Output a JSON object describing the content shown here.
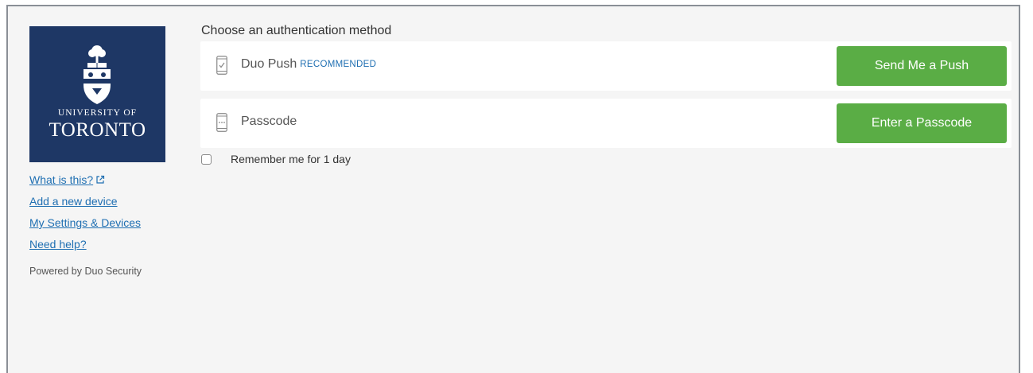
{
  "logo": {
    "line1": "UNIVERSITY OF",
    "line2": "TORONTO",
    "crest_icon": "university-crest-icon"
  },
  "sidebar": {
    "links": [
      {
        "label": "What is this?",
        "icon": "external-link-icon"
      },
      {
        "label": "Add a new device"
      },
      {
        "label": "My Settings & Devices"
      },
      {
        "label": "Need help?"
      }
    ],
    "powered_by": "Powered by Duo Security"
  },
  "main": {
    "heading": "Choose an authentication method",
    "methods": [
      {
        "name": "Duo Push",
        "badge": "RECOMMENDED",
        "icon": "phone-check-icon",
        "button_label": "Send Me a Push"
      },
      {
        "name": "Passcode",
        "badge": "",
        "icon": "phone-passcode-icon",
        "button_label": "Enter a Passcode"
      }
    ],
    "remember_label": "Remember me for 1 day"
  },
  "colors": {
    "logo_bg": "#1e3765",
    "button_bg": "#5aad45",
    "link": "#1f6fb2",
    "panel_bg": "#f5f5f5"
  }
}
